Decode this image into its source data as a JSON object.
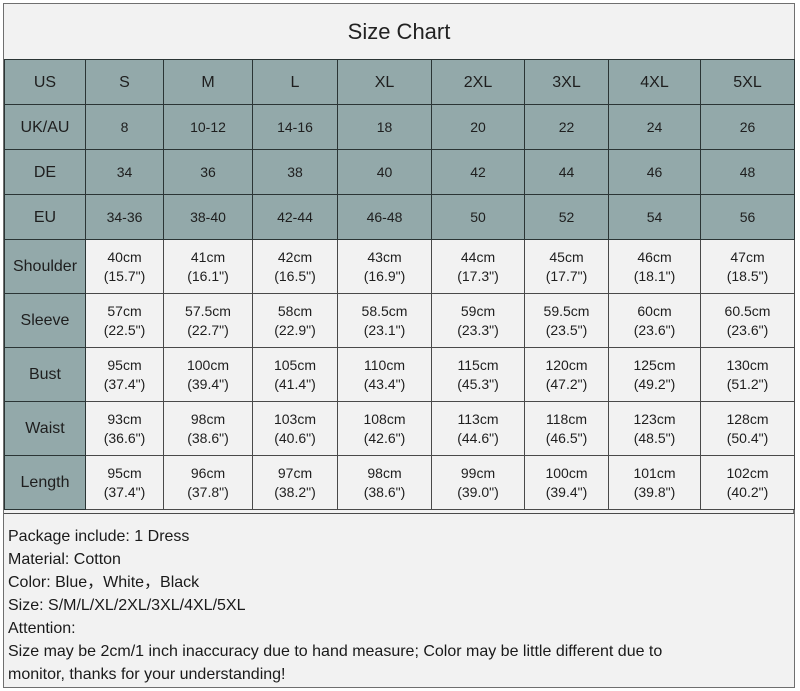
{
  "title": "Size Chart",
  "colors": {
    "header_fill": "#93a9aa",
    "cell_fill": "#f2f2f2",
    "border": "#2b3535",
    "text": "#1e1e1e"
  },
  "size_rows": [
    {
      "label": "US",
      "values": [
        "S",
        "M",
        "L",
        "XL",
        "2XL",
        "3XL",
        "4XL",
        "5XL"
      ]
    },
    {
      "label": "UK/AU",
      "values": [
        "8",
        "10-12",
        "14-16",
        "18",
        "20",
        "22",
        "24",
        "26"
      ]
    },
    {
      "label": "DE",
      "values": [
        "34",
        "36",
        "38",
        "40",
        "42",
        "44",
        "46",
        "48"
      ]
    },
    {
      "label": "EU",
      "values": [
        "34-36",
        "38-40",
        "42-44",
        "46-48",
        "50",
        "52",
        "54",
        "56"
      ]
    }
  ],
  "measurement_rows": [
    {
      "label": "Shoulder",
      "values": [
        {
          "cm": "40cm",
          "inch": "(15.7\")"
        },
        {
          "cm": "41cm",
          "inch": "(16.1\")"
        },
        {
          "cm": "42cm",
          "inch": "(16.5\")"
        },
        {
          "cm": "43cm",
          "inch": "(16.9\")"
        },
        {
          "cm": "44cm",
          "inch": "(17.3\")"
        },
        {
          "cm": "45cm",
          "inch": "(17.7\")"
        },
        {
          "cm": "46cm",
          "inch": "(18.1\")"
        },
        {
          "cm": "47cm",
          "inch": "(18.5\")"
        }
      ]
    },
    {
      "label": "Sleeve",
      "values": [
        {
          "cm": "57cm",
          "inch": "(22.5\")"
        },
        {
          "cm": "57.5cm",
          "inch": "(22.7\")"
        },
        {
          "cm": "58cm",
          "inch": "(22.9\")"
        },
        {
          "cm": "58.5cm",
          "inch": "(23.1\")"
        },
        {
          "cm": "59cm",
          "inch": "(23.3\")"
        },
        {
          "cm": "59.5cm",
          "inch": "(23.5\")"
        },
        {
          "cm": "60cm",
          "inch": "(23.6\")"
        },
        {
          "cm": "60.5cm",
          "inch": "(23.6\")"
        }
      ]
    },
    {
      "label": "Bust",
      "values": [
        {
          "cm": "95cm",
          "inch": "(37.4\")"
        },
        {
          "cm": "100cm",
          "inch": "(39.4\")"
        },
        {
          "cm": "105cm",
          "inch": "(41.4\")"
        },
        {
          "cm": "110cm",
          "inch": "(43.4\")"
        },
        {
          "cm": "115cm",
          "inch": "(45.3\")"
        },
        {
          "cm": "120cm",
          "inch": "(47.2\")"
        },
        {
          "cm": "125cm",
          "inch": "(49.2\")"
        },
        {
          "cm": "130cm",
          "inch": "(51.2\")"
        }
      ]
    },
    {
      "label": "Waist",
      "values": [
        {
          "cm": "93cm",
          "inch": "(36.6\")"
        },
        {
          "cm": "98cm",
          "inch": "(38.6\")"
        },
        {
          "cm": "103cm",
          "inch": "(40.6\")"
        },
        {
          "cm": "108cm",
          "inch": "(42.6\")"
        },
        {
          "cm": "113cm",
          "inch": "(44.6\")"
        },
        {
          "cm": "118cm",
          "inch": "(46.5\")"
        },
        {
          "cm": "123cm",
          "inch": "(48.5\")"
        },
        {
          "cm": "128cm",
          "inch": "(50.4\")"
        }
      ]
    },
    {
      "label": "Length",
      "values": [
        {
          "cm": "95cm",
          "inch": "(37.4\")"
        },
        {
          "cm": "96cm",
          "inch": "(37.8\")"
        },
        {
          "cm": "97cm",
          "inch": "(38.2\")"
        },
        {
          "cm": "98cm",
          "inch": "(38.6\")"
        },
        {
          "cm": "99cm",
          "inch": "(39.0\")"
        },
        {
          "cm": "100cm",
          "inch": "(39.4\")"
        },
        {
          "cm": "101cm",
          "inch": "(39.8\")"
        },
        {
          "cm": "102cm",
          "inch": "(40.2\")"
        }
      ]
    }
  ],
  "notes": [
    "Package include: 1 Dress",
    "Material: Cotton",
    "Color: Blue，White，Black",
    "Size: S/M/L/XL/2XL/3XL/4XL/5XL",
    "Attention:",
    "Size may be 2cm/1 inch inaccuracy due to hand measure; Color may be little different due to",
    "monitor, thanks for your understanding!"
  ]
}
